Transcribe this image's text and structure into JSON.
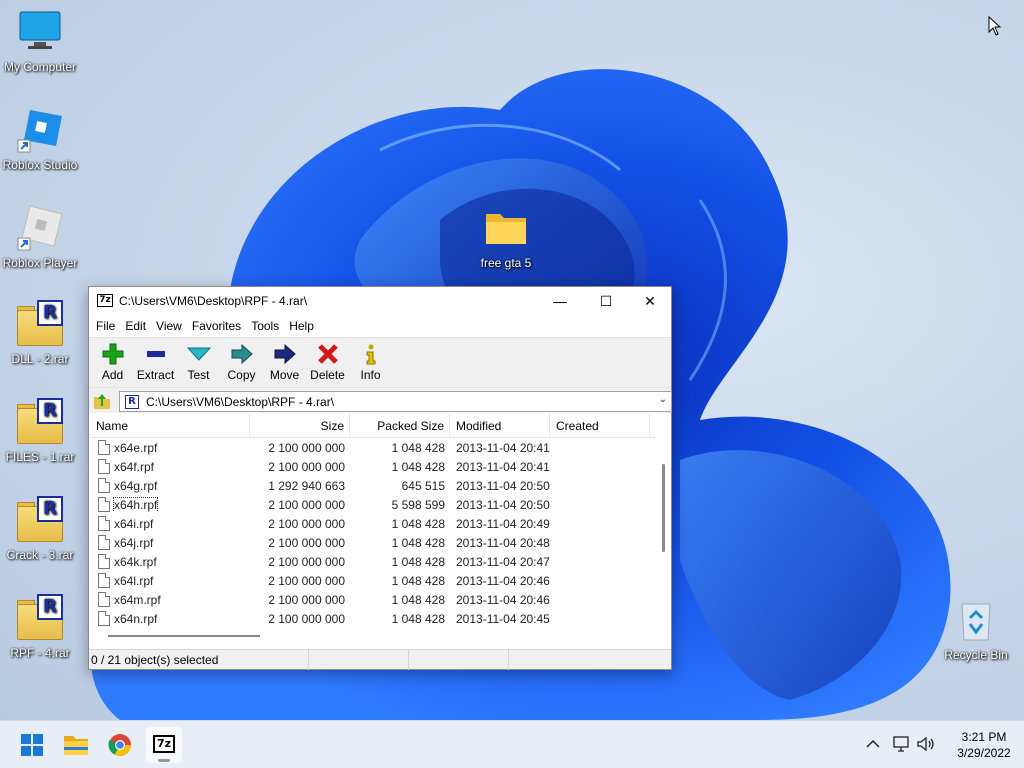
{
  "desktop": {
    "icons": [
      {
        "label": "My Computer"
      },
      {
        "label": "Roblox Studio"
      },
      {
        "label": "Roblox Player"
      },
      {
        "label": "DLL - 2.rar"
      },
      {
        "label": "FILES - 1.rar"
      },
      {
        "label": "Crack - 3.rar"
      },
      {
        "label": "RPF - 4.rar"
      },
      {
        "label": "free gta 5"
      },
      {
        "label": "Recycle Bin"
      }
    ]
  },
  "window": {
    "app_icon": "7z",
    "title": "C:\\Users\\VM6\\Desktop\\RPF - 4.rar\\",
    "controls": {
      "minimize": "—",
      "maximize": "☐",
      "close": "✕"
    },
    "menu": [
      "File",
      "Edit",
      "View",
      "Favorites",
      "Tools",
      "Help"
    ],
    "toolbar": [
      {
        "label": "Add",
        "icon": "plus-icon",
        "color": "#1aa31a"
      },
      {
        "label": "Extract",
        "icon": "minus-icon",
        "color": "#1b2a9e"
      },
      {
        "label": "Test",
        "icon": "check-icon",
        "color": "#2bb5c9"
      },
      {
        "label": "Copy",
        "icon": "arrow-right-double-icon",
        "color": "#2a8c8c"
      },
      {
        "label": "Move",
        "icon": "arrow-right-icon",
        "color": "#1b2a7a"
      },
      {
        "label": "Delete",
        "icon": "x-icon",
        "color": "#d01818"
      },
      {
        "label": "Info",
        "icon": "info-icon",
        "color": "#c9a800"
      }
    ],
    "address": {
      "path": "C:\\Users\\VM6\\Desktop\\RPF - 4.rar\\",
      "icon_letter": "R"
    },
    "columns": {
      "name": "Name",
      "size": "Size",
      "packed": "Packed Size",
      "modified": "Modified",
      "created": "Created"
    },
    "files": [
      {
        "name": "x64e.rpf",
        "size": "2 100 000 000",
        "packed": "1 048 428",
        "modified": "2013-11-04 20:41"
      },
      {
        "name": "x64f.rpf",
        "size": "2 100 000 000",
        "packed": "1 048 428",
        "modified": "2013-11-04 20:41"
      },
      {
        "name": "x64g.rpf",
        "size": "1 292 940 663",
        "packed": "645 515",
        "modified": "2013-11-04 20:50"
      },
      {
        "name": "x64h.rpf",
        "size": "2 100 000 000",
        "packed": "5 598 599",
        "modified": "2013-11-04 20:50"
      },
      {
        "name": "x64i.rpf",
        "size": "2 100 000 000",
        "packed": "1 048 428",
        "modified": "2013-11-04 20:49"
      },
      {
        "name": "x64j.rpf",
        "size": "2 100 000 000",
        "packed": "1 048 428",
        "modified": "2013-11-04 20:48"
      },
      {
        "name": "x64k.rpf",
        "size": "2 100 000 000",
        "packed": "1 048 428",
        "modified": "2013-11-04 20:47"
      },
      {
        "name": "x64l.rpf",
        "size": "2 100 000 000",
        "packed": "1 048 428",
        "modified": "2013-11-04 20:46"
      },
      {
        "name": "x64m.rpf",
        "size": "2 100 000 000",
        "packed": "1 048 428",
        "modified": "2013-11-04 20:46"
      },
      {
        "name": "x64n.rpf",
        "size": "2 100 000 000",
        "packed": "1 048 428",
        "modified": "2013-11-04 20:45"
      }
    ],
    "status": "0 / 21 object(s) selected"
  },
  "taskbar": {
    "apps": [
      "start-icon",
      "file-explorer-icon",
      "chrome-icon",
      "7zip-icon"
    ],
    "seven_zip_label": "7z",
    "time": "3:21 PM",
    "date": "3/29/2022"
  }
}
